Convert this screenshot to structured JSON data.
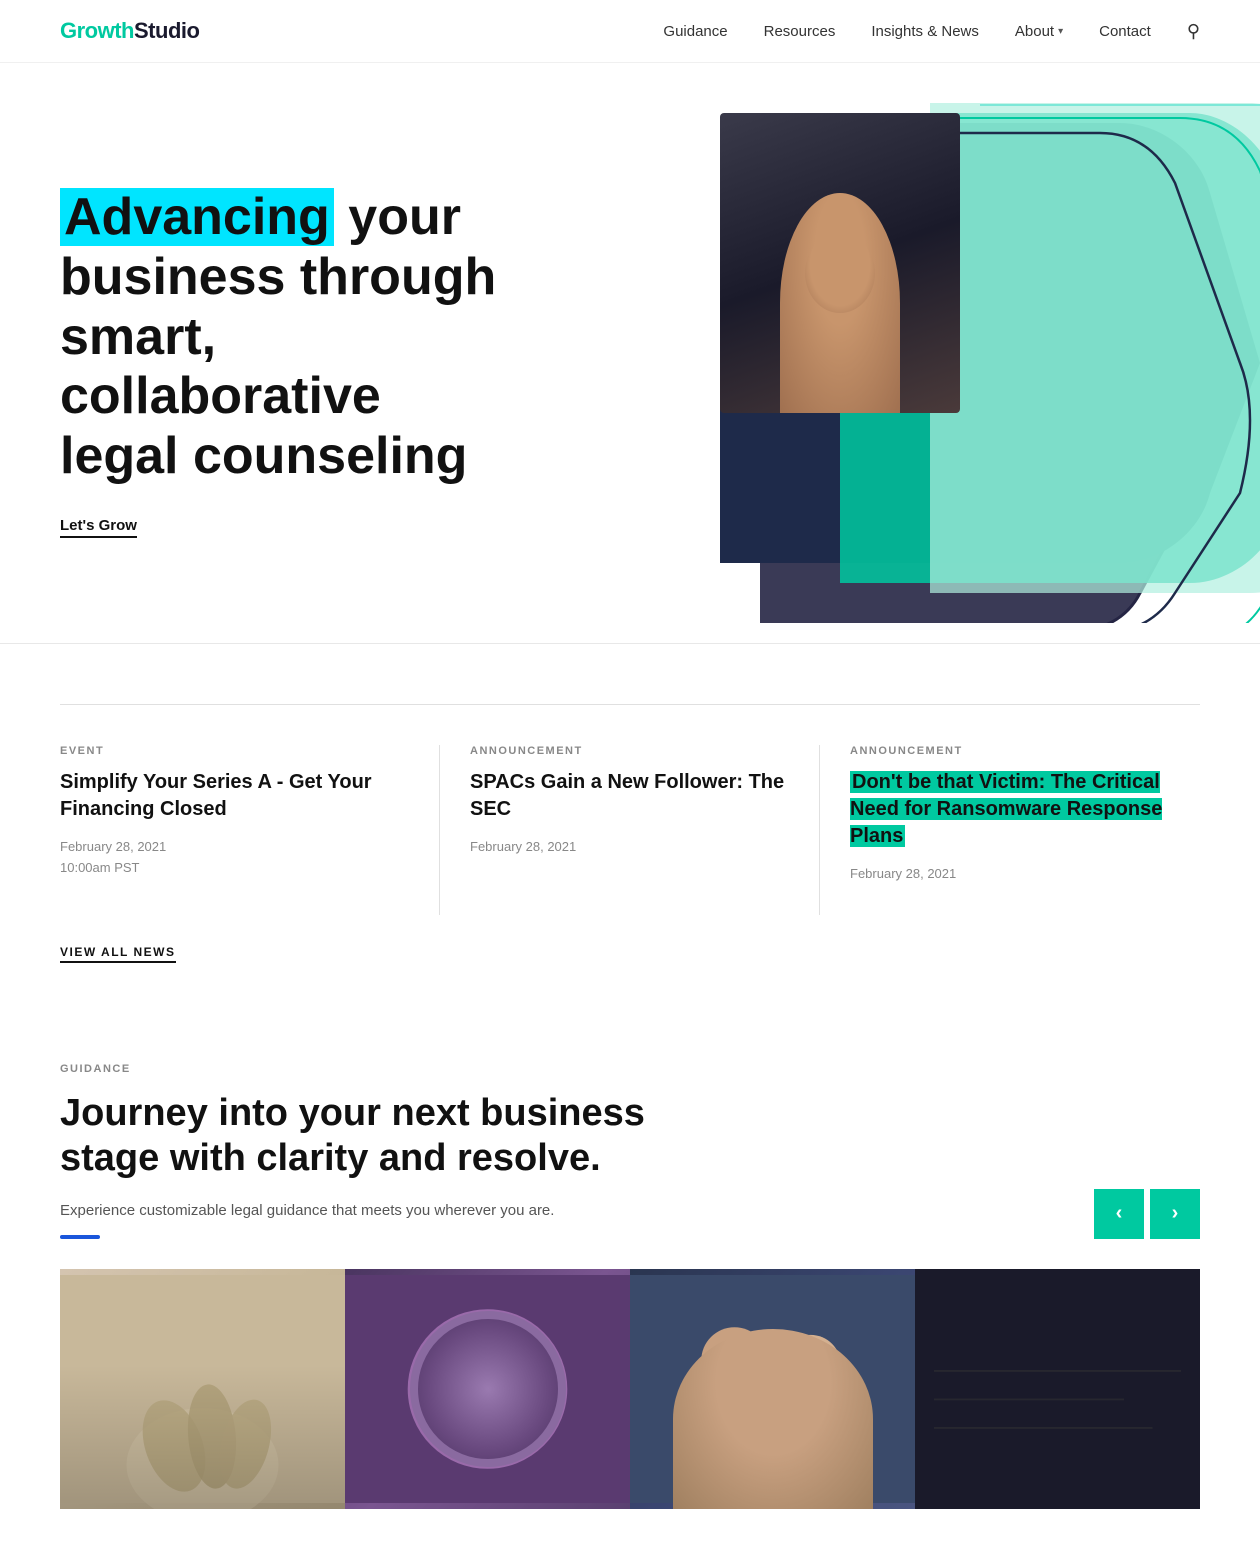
{
  "logo": {
    "part1": "Growth",
    "part2": "Studio"
  },
  "nav": {
    "items": [
      {
        "label": "Guidance",
        "hasDropdown": false
      },
      {
        "label": "Resources",
        "hasDropdown": false
      },
      {
        "label": "Insights & News",
        "hasDropdown": false
      },
      {
        "label": "About",
        "hasDropdown": true
      },
      {
        "label": "Contact",
        "hasDropdown": false
      }
    ]
  },
  "hero": {
    "headline_highlight": "Advancing",
    "headline_rest": " your business through smart, collaborative legal counseling",
    "cta_label": "Let's Grow"
  },
  "news": {
    "section_divider": true,
    "items": [
      {
        "tag": "EVENT",
        "title": "Simplify Your Series A - Get Your Financing Closed",
        "date": "February 28, 2021",
        "time": "10:00am PST",
        "highlight": false
      },
      {
        "tag": "ANNOUNCEMENT",
        "title": "SPACs Gain a New Follower: The SEC",
        "date": "February 28, 2021",
        "time": null,
        "highlight": false
      },
      {
        "tag": "ANNOUNCEMENT",
        "title": "Don't be that Victim: The Critical Need for Ransomware Response Plans",
        "date": "February 28, 2021",
        "time": null,
        "highlight": true
      }
    ],
    "view_all_label": "VIEW ALL NEWS"
  },
  "guidance": {
    "tag": "GUIDANCE",
    "title": "Journey into your next business stage with clarity and resolve.",
    "description": "Experience customizable legal guidance that meets you wherever you are.",
    "carousel_prev": "‹",
    "carousel_next": "›"
  },
  "cards": [
    {
      "id": "card-1",
      "style": "card-1"
    },
    {
      "id": "card-2",
      "style": "card-2"
    },
    {
      "id": "card-3",
      "style": "card-3"
    },
    {
      "id": "card-4",
      "style": "card-4"
    }
  ]
}
